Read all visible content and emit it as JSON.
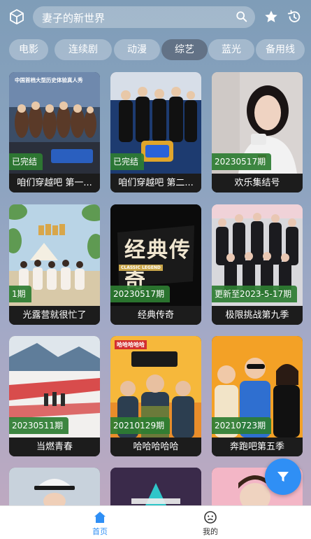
{
  "search": {
    "placeholder": "妻子的新世界"
  },
  "categories": [
    "电影",
    "连续剧",
    "动漫",
    "综艺",
    "蓝光",
    "备用线"
  ],
  "active_category": "综艺",
  "cards": [
    {
      "badge": "已完结",
      "title": "咱们穿越吧 第一..."
    },
    {
      "badge": "已完结",
      "title": "咱们穿越吧 第二..."
    },
    {
      "badge": "20230517期",
      "title": "欢乐集结号"
    },
    {
      "badge": "1期",
      "title": "光露营就很忙了"
    },
    {
      "badge": "20230517期",
      "title": "经典传奇"
    },
    {
      "badge": "更新至2023-5-17期",
      "title": "极限挑战第九季"
    },
    {
      "badge": "20230511期",
      "title": "当燃青春"
    },
    {
      "badge": "20210129期",
      "title": "哈哈哈哈哈"
    },
    {
      "badge": "20210723期",
      "title": "奔跑吧第五季"
    }
  ],
  "poster_text": {
    "p1_top": "中国首档大型历史体验真人秀",
    "p5_main": "经典传奇",
    "p5_small": "CLASSIC LEGEND",
    "p8_top": "哈哈哈哈哈"
  },
  "nav": {
    "home": "首页",
    "mine": "我的"
  },
  "colors": {
    "accent": "#2f8ff5",
    "badge": "#2e7d32"
  }
}
